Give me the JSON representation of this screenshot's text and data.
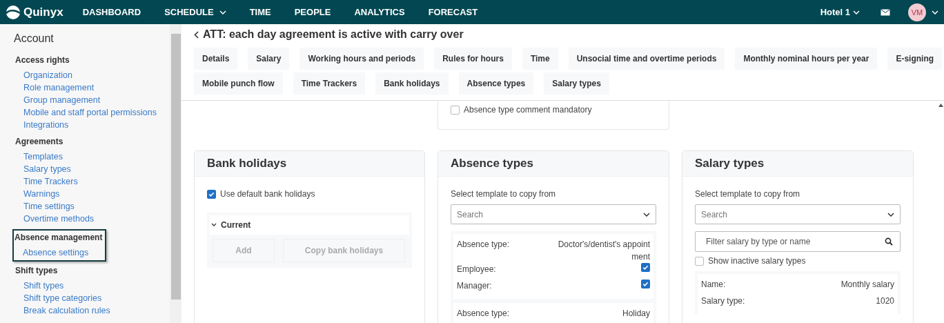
{
  "topbar": {
    "logo": "Quinyx",
    "nav": [
      {
        "label": "DASHBOARD",
        "dropdown": false
      },
      {
        "label": "SCHEDULE",
        "dropdown": true
      },
      {
        "label": "TIME",
        "dropdown": false
      },
      {
        "label": "PEOPLE",
        "dropdown": false
      },
      {
        "label": "ANALYTICS",
        "dropdown": false
      },
      {
        "label": "FORECAST",
        "dropdown": false
      }
    ],
    "unit": "Hotel 1",
    "avatar": "VM"
  },
  "sidebar": {
    "title": "Account",
    "groups": [
      {
        "heading": "Access rights",
        "highlighted": false,
        "items": [
          "Organization",
          "Role management",
          "Group management",
          "Mobile and staff portal permissions",
          "Integrations"
        ]
      },
      {
        "heading": "Agreements",
        "highlighted": false,
        "items": [
          "Templates",
          "Salary types",
          "Time Trackers",
          "Warnings",
          "Time settings",
          "Overtime methods"
        ]
      },
      {
        "heading": "Absence management",
        "highlighted": true,
        "items": [
          "Absence settings"
        ]
      },
      {
        "heading": "Shift types",
        "highlighted": false,
        "items": [
          "Shift types",
          "Shift type categories",
          "Break calculation rules"
        ]
      }
    ]
  },
  "page": {
    "title": "ATT: each day agreement is active with carry over",
    "tabs": [
      [
        "Details",
        "Salary",
        "Working hours and periods",
        "Rules for hours",
        "Time",
        "Unsocial time and overtime periods",
        "Monthly nominal hours per year",
        "E-signing"
      ],
      [
        "Mobile punch flow",
        "Time Trackers",
        "Bank holidays",
        "Absence types",
        "Salary types"
      ]
    ],
    "partial_card": {
      "checkbox": {
        "label": "Absence type comment mandatory",
        "checked": false
      }
    },
    "bank_holidays": {
      "title": "Bank holidays",
      "checkbox": {
        "label": "Use default bank holidays",
        "checked": true
      },
      "section": {
        "label": "Current",
        "expanded": true,
        "buttons": [
          {
            "label": "Add",
            "disabled": true
          },
          {
            "label": "Copy bank holidays",
            "disabled": true
          }
        ]
      }
    },
    "absence_types": {
      "title": "Absence types",
      "select_label": "Select template to copy from",
      "select": {
        "placeholder": "Search"
      },
      "items": [
        {
          "rows": [
            {
              "kind": "text",
              "label": "Absence type:",
              "value": "Doctor's/dentist's appointment"
            },
            {
              "kind": "checkbox",
              "label": "Employee:",
              "checked": true
            },
            {
              "kind": "checkbox",
              "label": "Manager:",
              "checked": true
            }
          ]
        },
        {
          "rows": [
            {
              "kind": "text",
              "label": "Absence type:",
              "value": "Holiday"
            }
          ]
        }
      ]
    },
    "salary_types": {
      "title": "Salary types",
      "select_label": "Select template to copy from",
      "select": {
        "placeholder": "Search"
      },
      "filter": {
        "placeholder": "Filter salary by type or name"
      },
      "checkbox": {
        "label": "Show inactive salary types",
        "checked": false
      },
      "items": [
        {
          "rows": [
            {
              "label": "Name:",
              "value": "Monthly salary"
            },
            {
              "label": "Salary type:",
              "value": "1020"
            }
          ]
        }
      ]
    }
  }
}
